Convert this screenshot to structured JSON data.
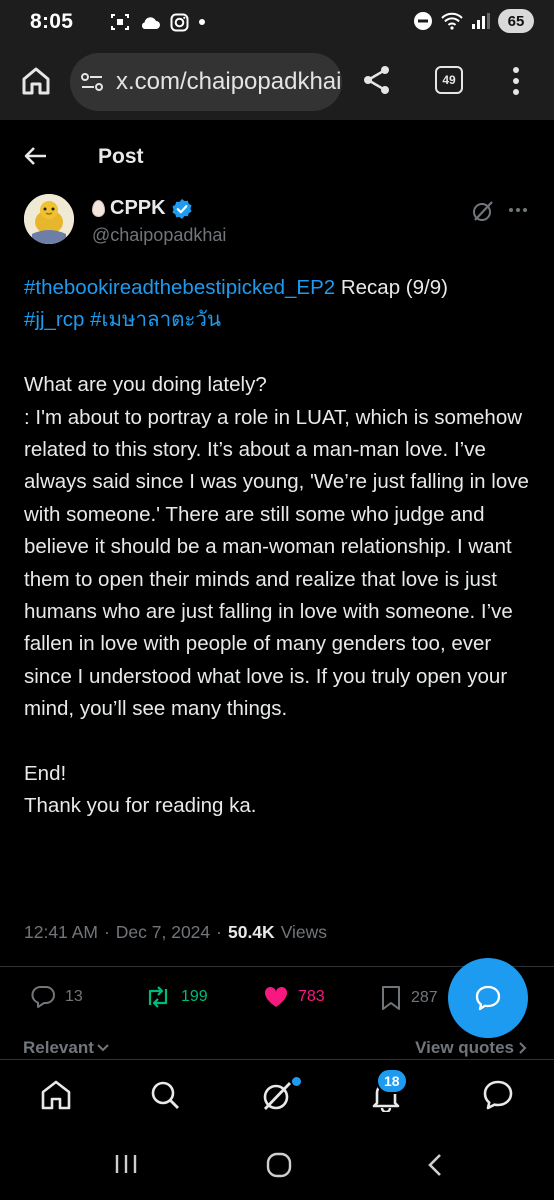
{
  "status_bar": {
    "time": "8:05",
    "battery": "65"
  },
  "browser": {
    "url": "x.com/chaipopadkhai",
    "tab_count": "49"
  },
  "header": {
    "title": "Post"
  },
  "author": {
    "name": "CPPK",
    "handle": "@chaipopadkhai",
    "verified": true
  },
  "post": {
    "hashtag1": "#thebookireadthebestipicked_EP2",
    "recap": " Recap (9/9)",
    "hashtag2": "#jj_rcp",
    "hashtag3": "#เมษาลาตะวัน",
    "question": "What are you doing lately?",
    "answer": ": I'm about to portray a role in LUAT, which is somehow related to this story. It’s about a man-man love. I’ve always said since I was young, 'We’re just falling in love with someone.' There are still some who judge and believe it should be a man-woman relationship. I want them to open their minds and realize that love is just humans who are just falling in love with someone. I’ve fallen in love with people of many genders too, ever since I understood what love is. If you truly open your mind, you’ll see many things.",
    "end_line1": "End!",
    "end_line2": "Thank you for reading ka."
  },
  "meta": {
    "time": "12:41 AM",
    "separator": "·",
    "date": "Dec 7, 2024",
    "views_count": "50.4K",
    "views_label": "Views"
  },
  "actions": {
    "replies": "13",
    "reposts": "199",
    "likes": "783",
    "bookmarks": "287"
  },
  "replies_sort": {
    "label": "Relevant"
  },
  "view_quotes": {
    "label": "View quotes"
  },
  "bottom_nav": {
    "notifications_badge": "18"
  },
  "colors": {
    "accent": "#1d9bf0",
    "repost": "#00ba7c",
    "like": "#f91880",
    "muted": "#71767b"
  }
}
